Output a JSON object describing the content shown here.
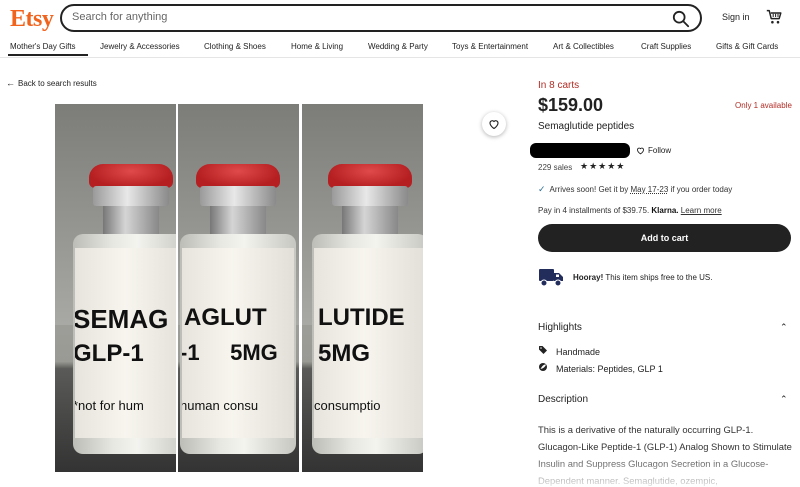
{
  "header": {
    "logo": "Etsy",
    "search_placeholder": "Search for anything",
    "signin": "Sign in"
  },
  "categories": [
    "Mother's Day Gifts",
    "Jewelry & Accessories",
    "Clothing & Shoes",
    "Home & Living",
    "Wedding & Party",
    "Toys & Entertainment",
    "Art & Collectibles",
    "Craft Supplies",
    "Gifts & Gift Cards"
  ],
  "back_link": "Back to search results",
  "photos": [
    {
      "lines": [
        "SEMAG",
        "GLP-1",
        "*not for hum"
      ]
    },
    {
      "lines": [
        "AGLUT",
        "-1     5MG",
        "human consu"
      ]
    },
    {
      "lines": [
        "LUTIDE",
        "5MG",
        "consumptio"
      ]
    }
  ],
  "product": {
    "in_carts": "In 8 carts",
    "price": "$159.00",
    "stock": "Only 1 available",
    "title": "Semaglutide peptides",
    "follow": "Follow",
    "sales": "229 sales",
    "stars": "★★★★★",
    "arrives_prefix": "Arrives soon! Get it by ",
    "arrives_date": "May 17-23",
    "arrives_suffix": " if you order today",
    "klarna_prefix": "Pay in 4 installments of $39.75. ",
    "klarna_brand": "Klarna.",
    "klarna_link": "Learn more",
    "add_to_cart": "Add to cart",
    "shipping_bold": "Hooray!",
    "shipping_text": " This item ships free to the US."
  },
  "highlights": {
    "title": "Highlights",
    "items": [
      "Handmade",
      "Materials: Peptides, GLP 1"
    ]
  },
  "description": {
    "title": "Description",
    "text": "This is a derivative of the naturally occurring GLP-1. Glucagon-Like Peptide-1 (GLP-1) Analog Shown to Stimulate Insulin and Suppress Glucagon Secretion in a Glucose-Dependent manner. Semaglutide, ozempic,"
  },
  "colors": {
    "brand": "#f1641e",
    "accent_red": "#b12d25",
    "button": "#222222"
  },
  "icons": [
    "search-icon",
    "cart-icon",
    "heart-icon",
    "check-icon",
    "truck-icon",
    "tag-icon",
    "leaf-icon",
    "chevron-up-icon",
    "arrow-left-icon"
  ]
}
